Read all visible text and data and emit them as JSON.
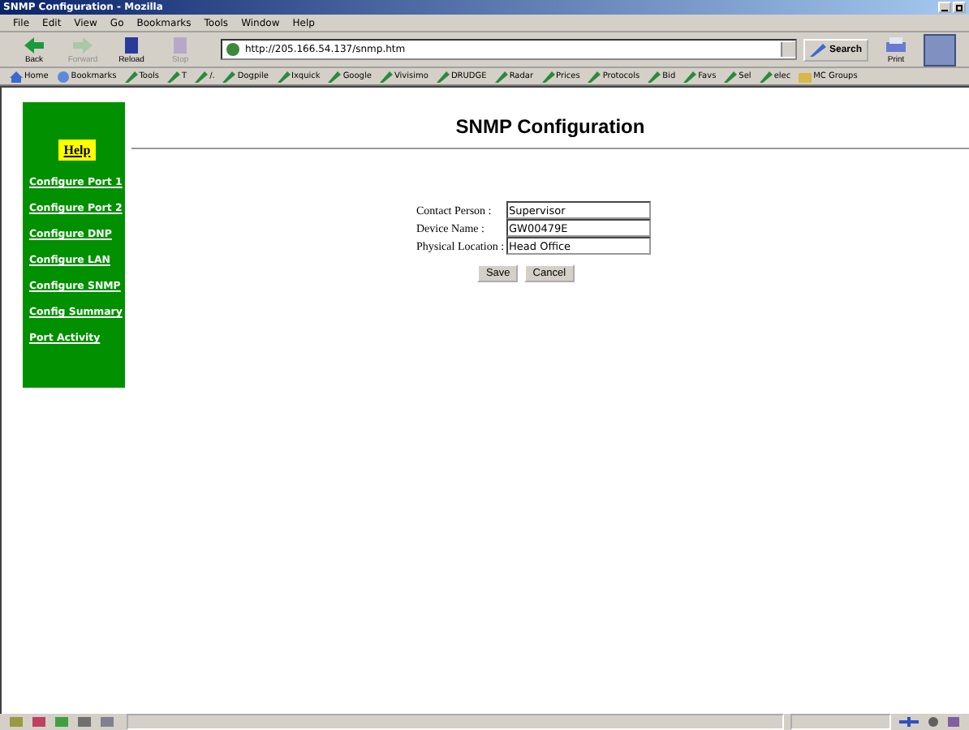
{
  "window": {
    "title": "SNMP Configuration - Mozilla"
  },
  "menu": [
    "File",
    "Edit",
    "View",
    "Go",
    "Bookmarks",
    "Tools",
    "Window",
    "Help"
  ],
  "toolbar": [
    {
      "label": "Back",
      "disabled": false
    },
    {
      "label": "Forward",
      "disabled": true
    },
    {
      "label": "Reload",
      "disabled": false
    },
    {
      "label": "Stop",
      "disabled": true
    }
  ],
  "address": {
    "value": "http://205.166.54.137/snmp.htm"
  },
  "search_button": "Search",
  "print_button": "Print",
  "bookmarks": [
    {
      "label": "Home",
      "kind": "home"
    },
    {
      "label": "Bookmarks",
      "kind": "bookmarks"
    },
    {
      "label": "Tools",
      "kind": "link"
    },
    {
      "label": "T",
      "kind": "link"
    },
    {
      "label": "/.",
      "kind": "link"
    },
    {
      "label": "Dogpile",
      "kind": "link"
    },
    {
      "label": "Ixquick",
      "kind": "link"
    },
    {
      "label": "Google",
      "kind": "link"
    },
    {
      "label": "Vivisimo",
      "kind": "link"
    },
    {
      "label": "DRUDGE",
      "kind": "link"
    },
    {
      "label": "Radar",
      "kind": "link"
    },
    {
      "label": "Prices",
      "kind": "link"
    },
    {
      "label": "Protocols",
      "kind": "link"
    },
    {
      "label": "Bid",
      "kind": "link"
    },
    {
      "label": "Favs",
      "kind": "link"
    },
    {
      "label": "Sel",
      "kind": "link"
    },
    {
      "label": "elec",
      "kind": "link"
    },
    {
      "label": "MC Groups",
      "kind": "folder"
    }
  ],
  "sidebar": {
    "help": "Help",
    "items": [
      "Configure Port 1",
      "Configure Port 2",
      "Configure DNP",
      "Configure LAN",
      "Configure SNMP",
      "Config Summary",
      "Port Activity"
    ]
  },
  "page": {
    "heading": "SNMP Configuration",
    "fields": [
      {
        "label": "Contact Person :",
        "value": "Supervisor"
      },
      {
        "label": "Device Name :",
        "value": "GW00479E"
      },
      {
        "label": "Physical Location :",
        "value": "Head Office"
      }
    ],
    "buttons": [
      "Save",
      "Cancel"
    ]
  }
}
